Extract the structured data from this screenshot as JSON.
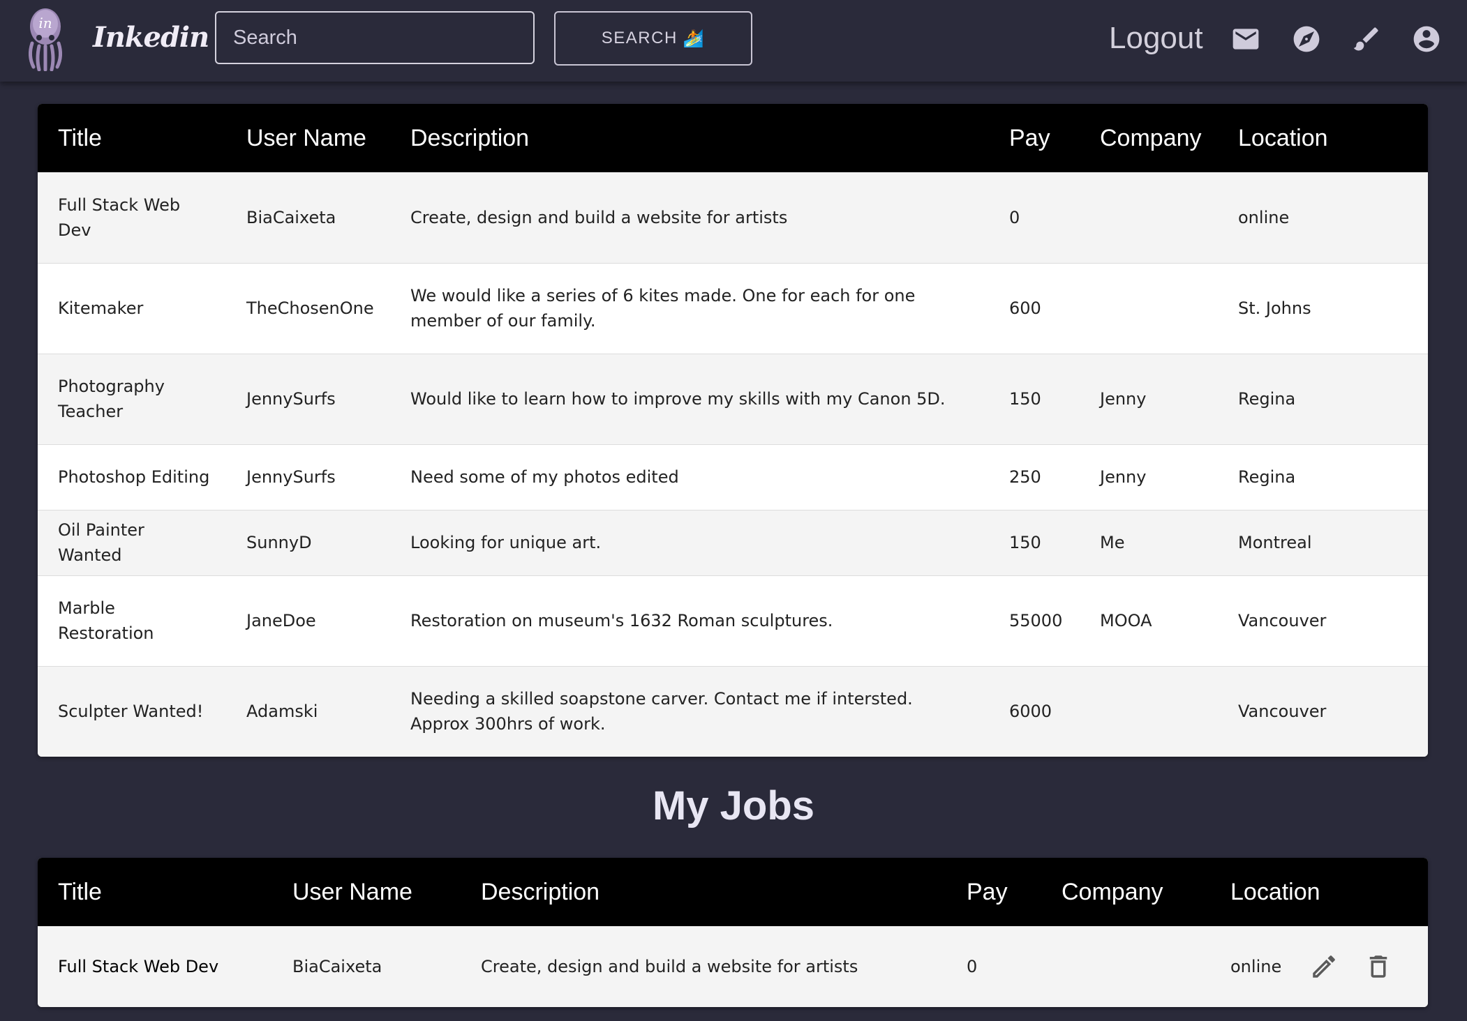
{
  "header": {
    "brand": "Inkedin",
    "logo_letters": "in",
    "search_placeholder": "Search",
    "search_button_label": "SEARCH",
    "search_button_emoji": "🏄",
    "logout_label": "Logout",
    "icons": [
      "mail-icon",
      "compass-icon",
      "brush-icon",
      "account-icon"
    ]
  },
  "jobs_table": {
    "columns": [
      "Title",
      "User Name",
      "Description",
      "Pay",
      "Company",
      "Location"
    ],
    "rows": [
      {
        "title": "Full Stack Web Dev",
        "user": "BiaCaixeta",
        "description": "Create, design and build a website for artists",
        "pay": "0",
        "company": "",
        "location": "online"
      },
      {
        "title": "Kitemaker",
        "user": "TheChosenOne",
        "description": "We would like a series of 6 kites made. One for each for one member of our family.",
        "pay": "600",
        "company": "",
        "location": "St. Johns"
      },
      {
        "title": "Photography Teacher",
        "user": "JennySurfs",
        "description": "Would like to learn how to improve my skills with my Canon 5D.",
        "pay": "150",
        "company": "Jenny",
        "location": "Regina"
      },
      {
        "title": "Photoshop Editing",
        "user": "JennySurfs",
        "description": "Need some of my photos edited",
        "pay": "250",
        "company": "Jenny",
        "location": "Regina"
      },
      {
        "title": "Oil Painter Wanted",
        "user": "SunnyD",
        "description": "Looking for unique art.",
        "pay": "150",
        "company": "Me",
        "location": "Montreal"
      },
      {
        "title": "Marble Restoration",
        "user": "JaneDoe",
        "description": "Restoration on museum's 1632 Roman sculptures.",
        "pay": "55000",
        "company": "MOOA",
        "location": "Vancouver"
      },
      {
        "title": "Sculpter Wanted!",
        "user": "Adamski",
        "description": "Needing a skilled soapstone carver. Contact me if intersted. Approx 300hrs of work.",
        "pay": "6000",
        "company": "",
        "location": "Vancouver"
      }
    ]
  },
  "my_jobs": {
    "heading": "My Jobs",
    "columns": [
      "Title",
      "User Name",
      "Description",
      "Pay",
      "Company",
      "Location"
    ],
    "rows": [
      {
        "title": "Full Stack Web Dev",
        "user": "BiaCaixeta",
        "description": "Create, design and build a website for artists",
        "pay": "0",
        "company": "",
        "location": "online",
        "actions": [
          "edit-icon",
          "delete-icon"
        ]
      }
    ]
  },
  "colors": {
    "background": "#2a2a3a",
    "table_header": "#000000",
    "row_odd": "#f4f4f4",
    "row_even": "#ffffff"
  }
}
